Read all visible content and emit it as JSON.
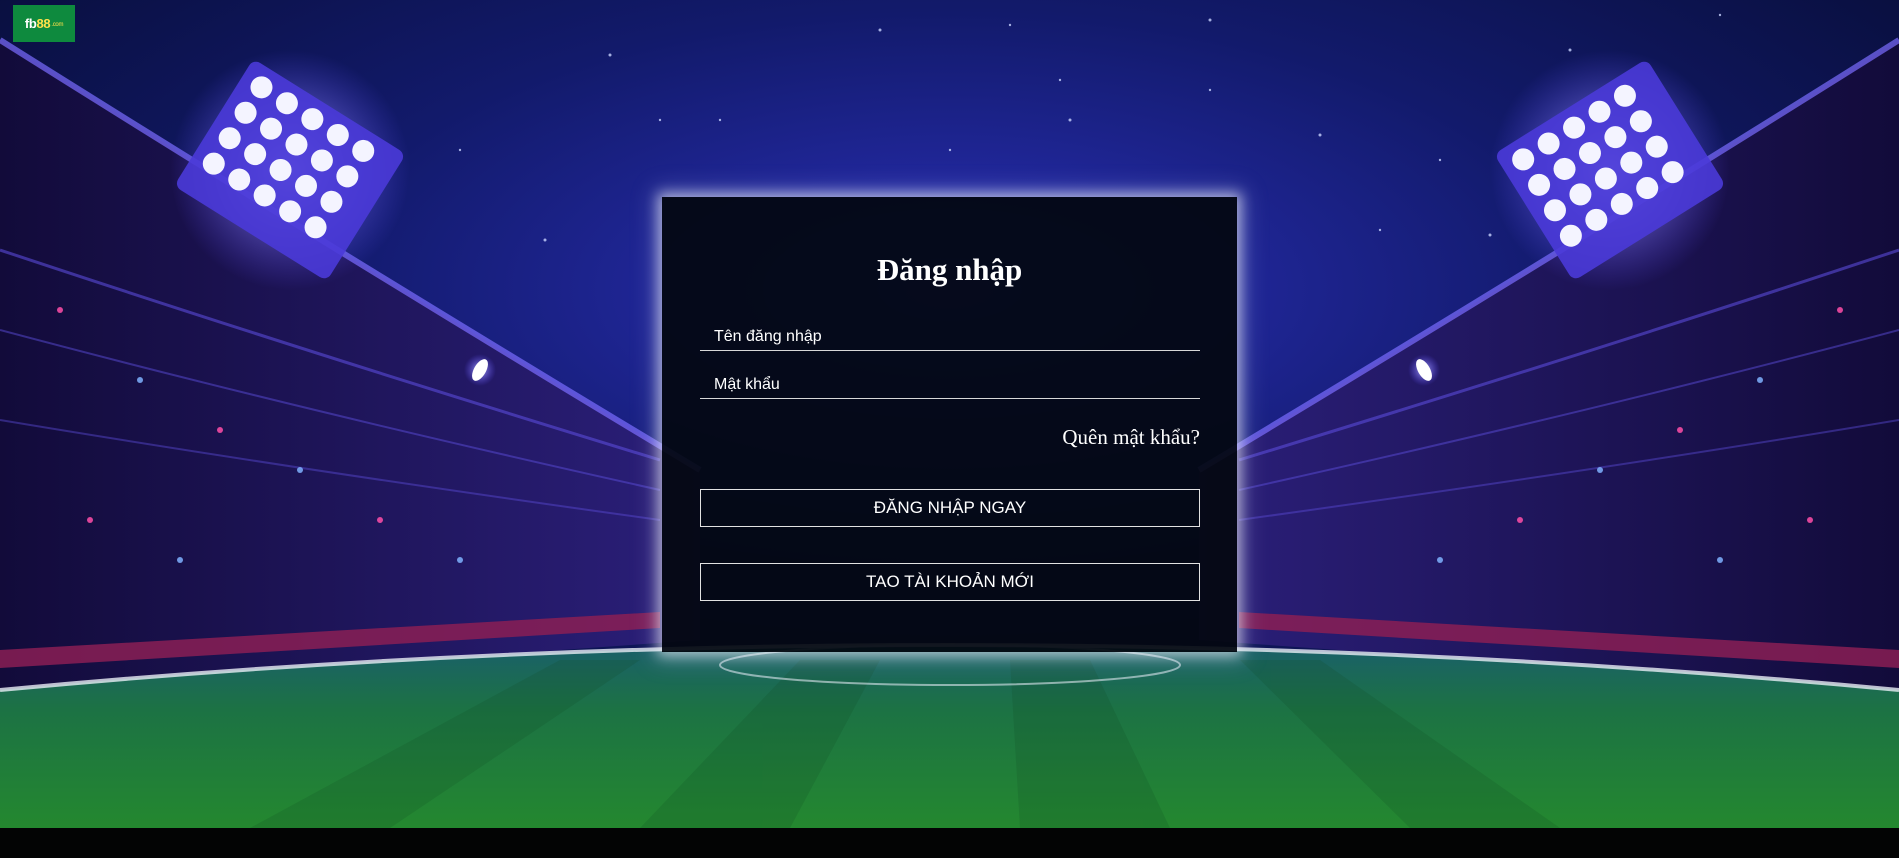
{
  "brand": {
    "logo_main": "fb",
    "logo_num": "88",
    "logo_domain": ".com"
  },
  "login": {
    "title": "Đăng nhập",
    "username_placeholder": "Tên đăng nhập",
    "password_placeholder": "Mật khẩu",
    "forgot_password": "Quên mật khẩu?",
    "login_button": "ĐĂNG NHẬP NGAY",
    "register_button": "TAO TÀI KHOẢN MỚI"
  },
  "colors": {
    "logo_bg": "#0e8a3e",
    "sky_top": "#07103a",
    "sky_glow": "#3b2fd8",
    "pitch": "#1f7a3a",
    "panel_bg": "#030710"
  }
}
